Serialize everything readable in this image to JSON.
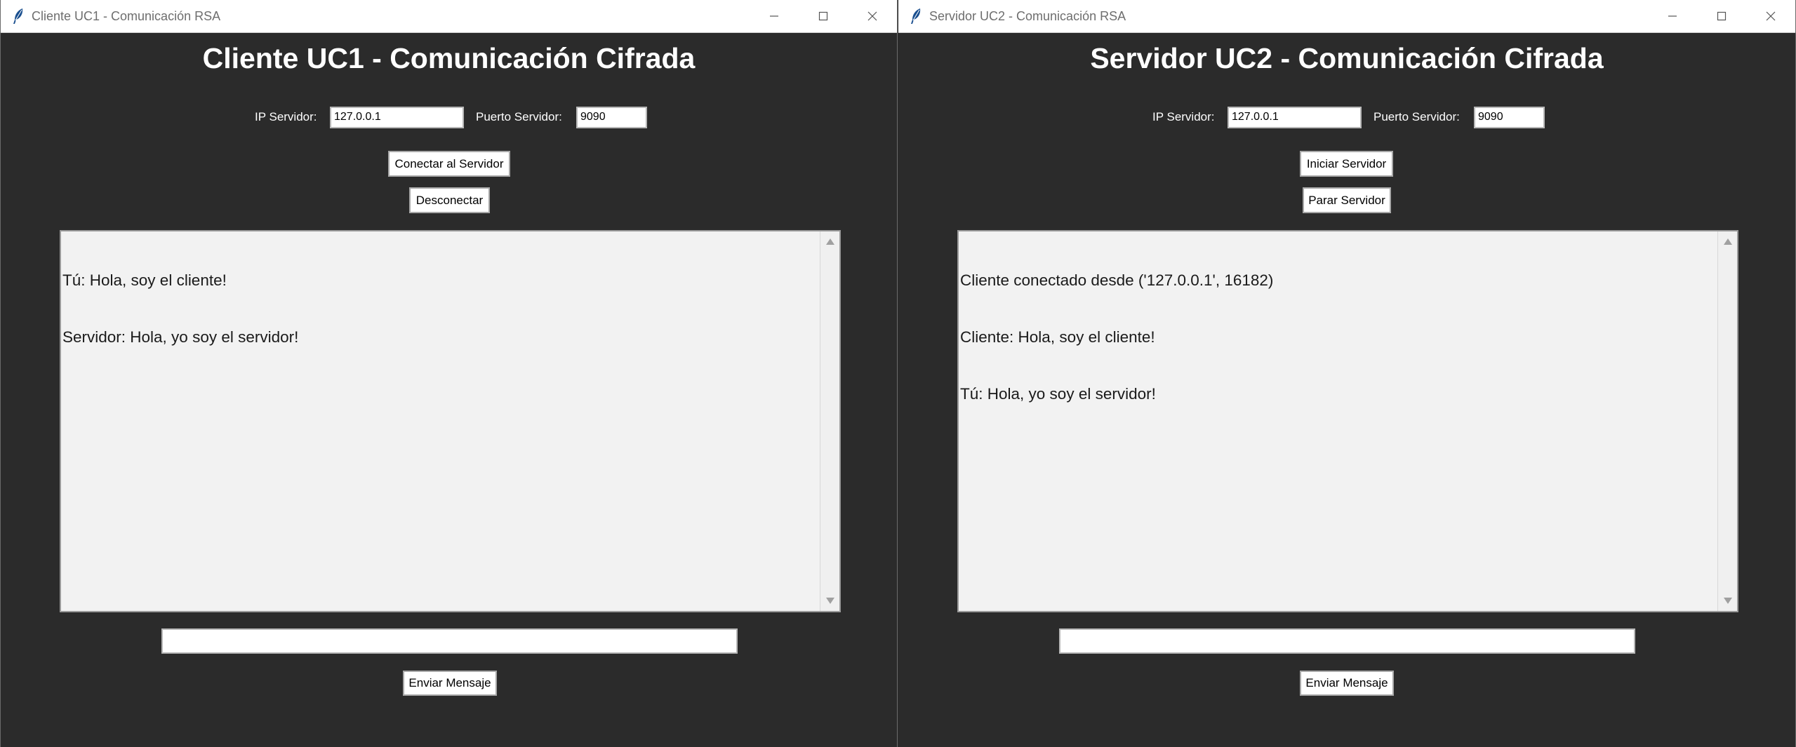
{
  "left": {
    "window_title": "Cliente UC1 - Comunicación RSA",
    "heading": "Cliente UC1 - Comunicación Cifrada",
    "ip_label": "IP Servidor:",
    "ip_value": "127.0.0.1",
    "port_label": "Puerto Servidor:",
    "port_value": "9090",
    "primary_button": "Conectar al Servidor",
    "secondary_button": "Desconectar",
    "chat_lines": [
      "Tú: Hola, soy el cliente!",
      "Servidor: Hola, yo soy el servidor!"
    ],
    "message_value": "",
    "send_button": "Enviar Mensaje"
  },
  "right": {
    "window_title": "Servidor UC2 - Comunicación RSA",
    "heading": "Servidor UC2 - Comunicación Cifrada",
    "ip_label": "IP Servidor:",
    "ip_value": "127.0.0.1",
    "port_label": "Puerto Servidor:",
    "port_value": "9090",
    "primary_button": "Iniciar Servidor",
    "secondary_button": "Parar Servidor",
    "chat_lines": [
      "Cliente conectado desde ('127.0.0.1', 16182)",
      "Cliente: Hola, soy el cliente!",
      "Tú: Hola, yo soy el servidor!"
    ],
    "message_value": "",
    "send_button": "Enviar Mensaje"
  },
  "icons": {
    "app": "feather-icon",
    "minimize": "minimize-icon",
    "maximize": "maximize-icon",
    "close": "close-icon"
  },
  "colors": {
    "background": "#2b2b2b",
    "chat_background": "#f2f2f2",
    "text_light": "#ffffff"
  }
}
